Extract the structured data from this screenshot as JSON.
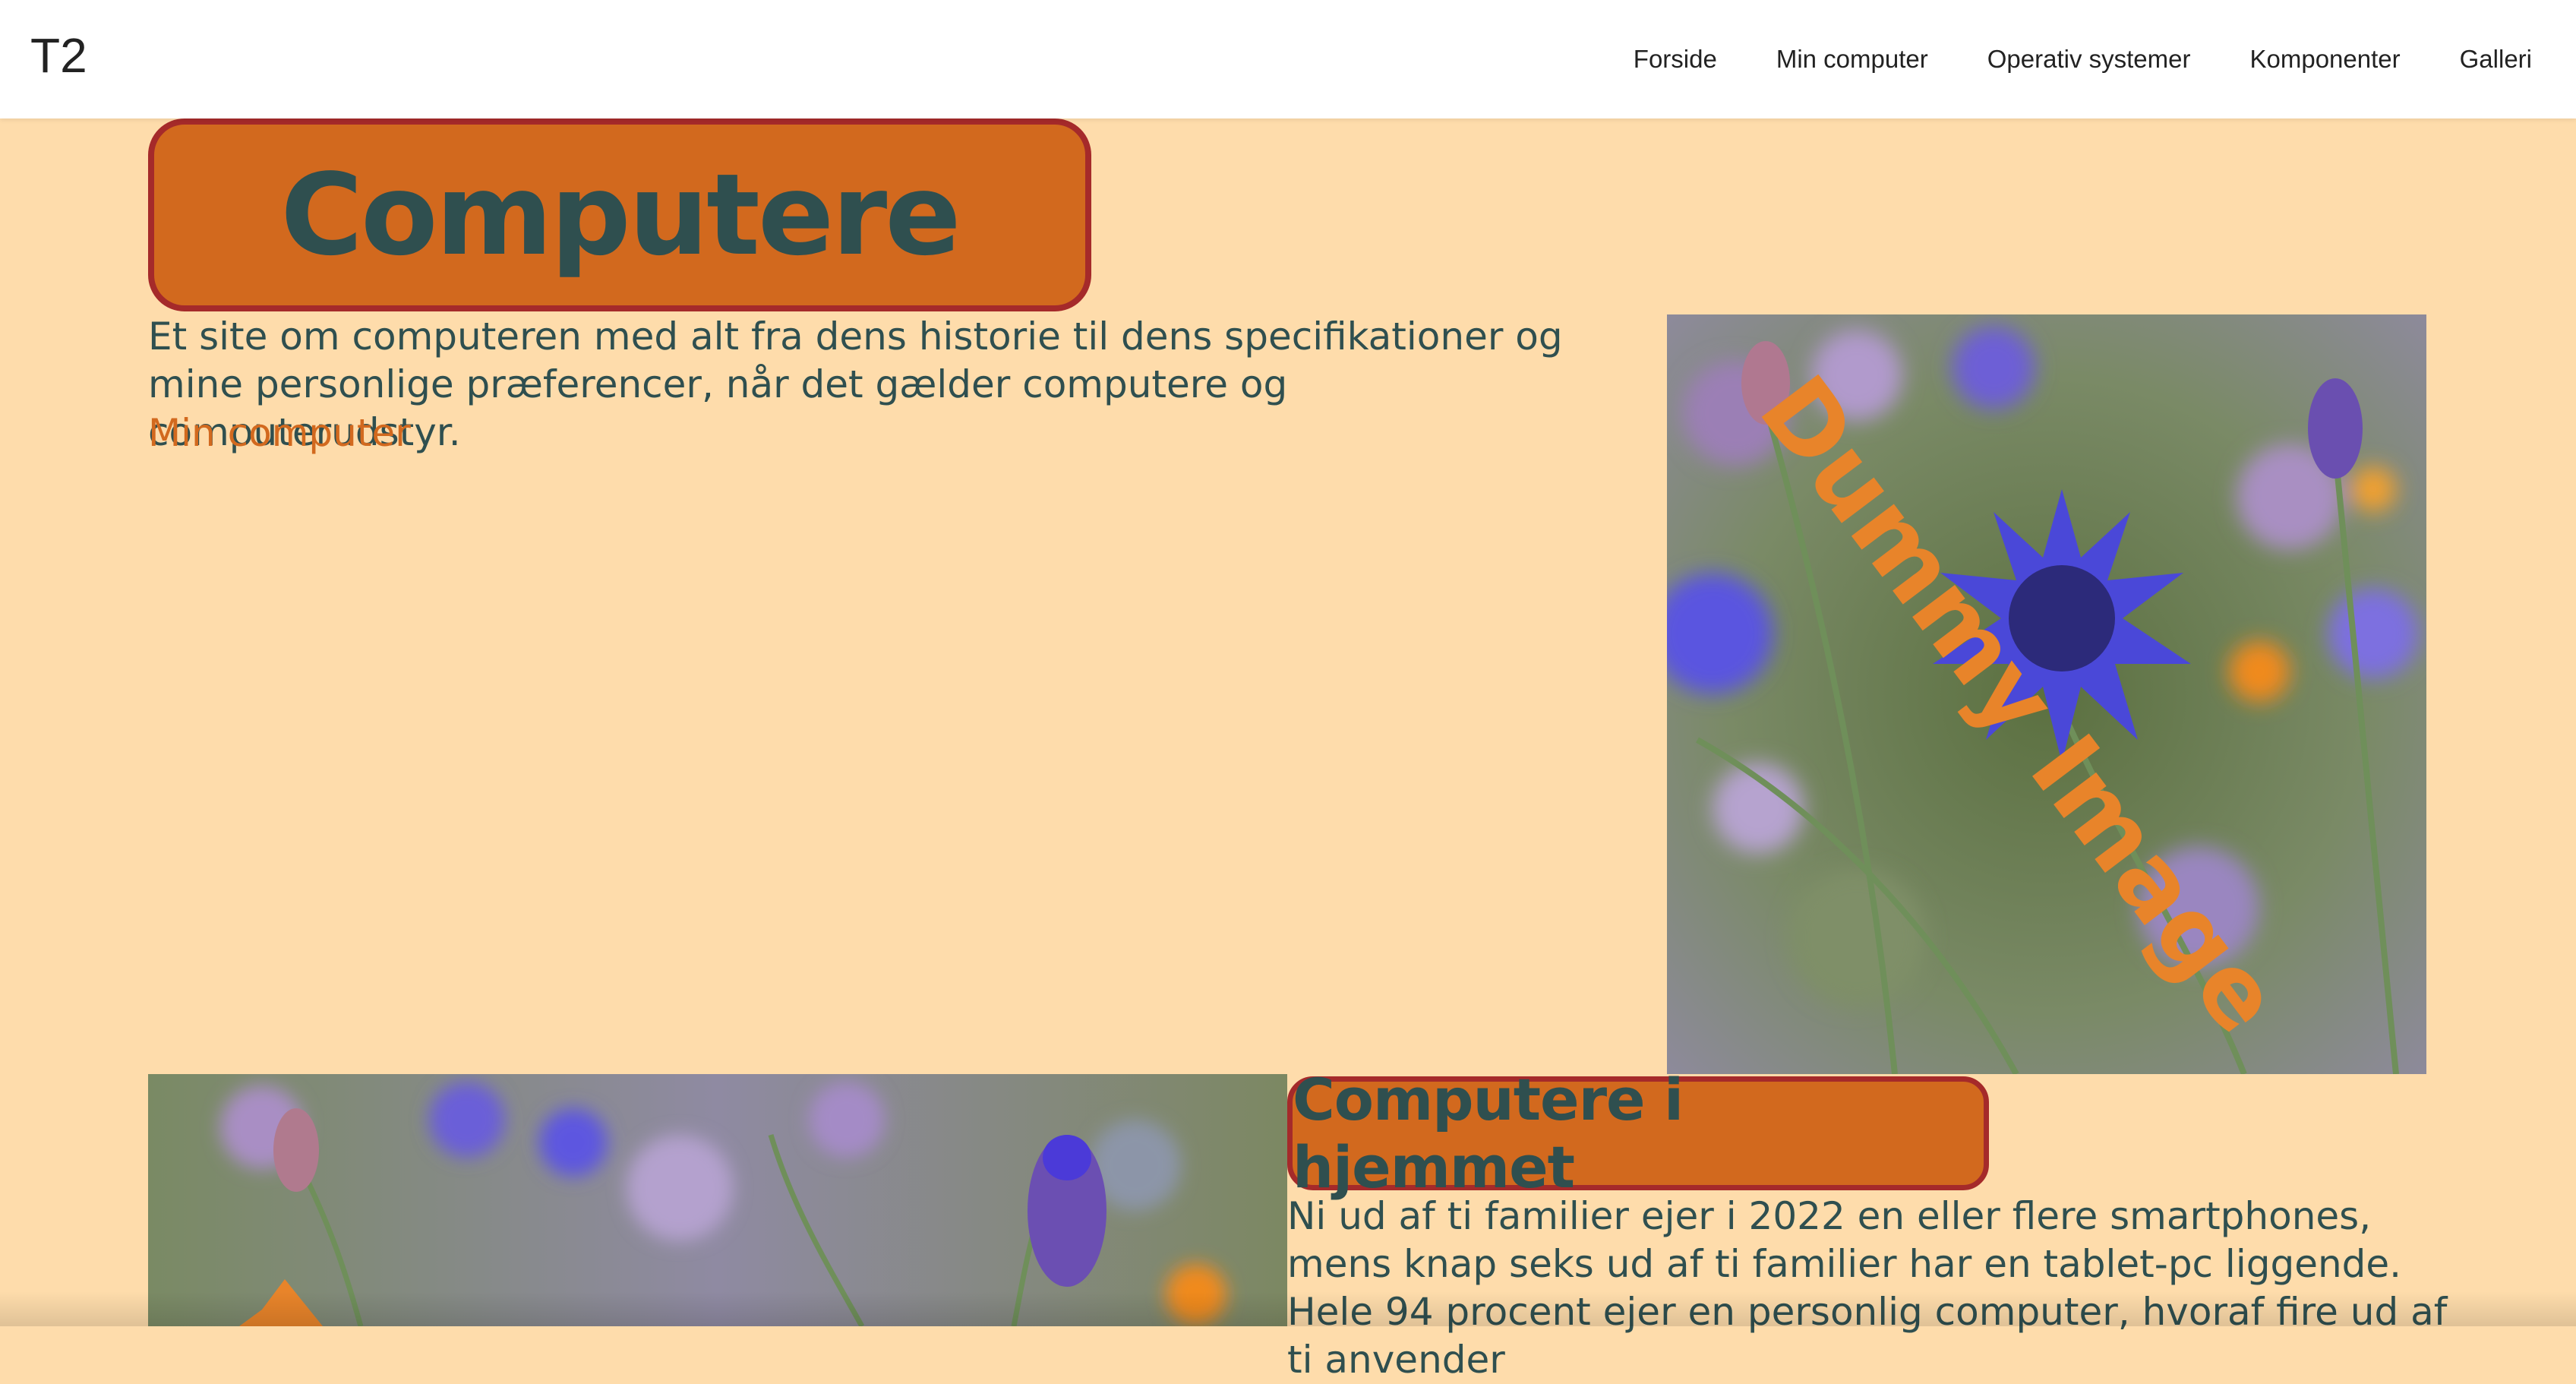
{
  "navbar": {
    "brand": "T2",
    "links": [
      "Forside",
      "Min computer",
      "Operativ systemer",
      "Komponenter",
      "Galleri"
    ]
  },
  "hero": {
    "title": "Computere",
    "description": "Et site om computeren med alt fra dens historie til dens specifikationer og mine personlige præferencer, når det gælder computere og computerudstyr.",
    "link_label": "Min computer",
    "image_overlay_text": "Dummy Image"
  },
  "section": {
    "title": "Computere i hjemmet",
    "body": "Ni ud af ti familier ejer i 2022 en eller flere smartphones, mens knap seks ud af ti familier har en tablet-pc liggende. Hele 94 procent ejer en personlig computer, hvoraf fire ud af ti anvender"
  },
  "colors": {
    "page_background": "#fedcab",
    "accent": "#d2691e",
    "border": "#a52a2a",
    "text": "#2f4f4f",
    "overlay_text": "#e8842a"
  }
}
